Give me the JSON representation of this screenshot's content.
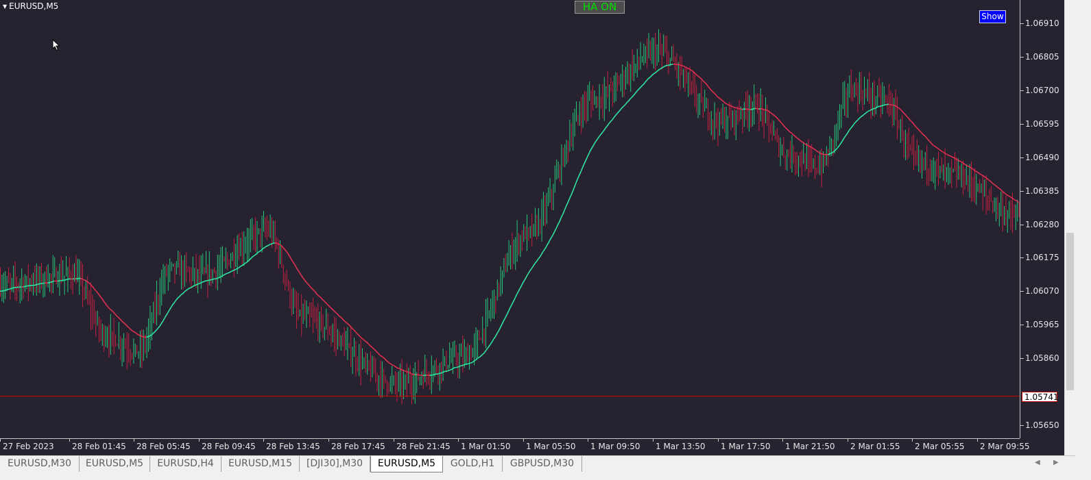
{
  "chart": {
    "symbol": "EURUSD,M5",
    "ha_button_label": "HA ON",
    "show_button_label": "Show",
    "current_price": "1.05741",
    "colors": {
      "background": "#272230",
      "bull": "#27c77a",
      "bear": "#c4213f",
      "ha_bull_line": "#2ee6a0",
      "ha_bear_line": "#e03050",
      "price_line": "#d00000",
      "scale_text": "#e6e6e6",
      "ha_text": "#00e000",
      "show_bg": "#0000ff"
    },
    "icons": [
      "triangle-down-icon",
      "mouse-cursor-icon",
      "arrow-left-icon",
      "arrow-right-icon"
    ]
  },
  "chart_data": {
    "type": "line",
    "x": [
      "27 Feb 2023",
      "28 Feb 01:45",
      "28 Feb 05:45",
      "28 Feb 09:45",
      "28 Feb 13:45",
      "28 Feb 17:45",
      "28 Feb 21:45",
      "1 Mar 01:50",
      "1 Mar 05:50",
      "1 Mar 09:50",
      "1 Mar 13:50",
      "1 Mar 17:50",
      "1 Mar 21:50",
      "2 Mar 01:55",
      "2 Mar 05:55",
      "2 Mar 09:55"
    ],
    "price_ticks": [
      "1.06910",
      "1.06805",
      "1.06700",
      "1.06595",
      "1.06490",
      "1.06385",
      "1.06280",
      "1.06175",
      "1.06070",
      "1.05965",
      "1.05860",
      "1.05650"
    ],
    "ylim": [
      1.0565,
      1.0691
    ],
    "price_line": 1.05741,
    "series": [
      {
        "values": [
          1.0609,
          1.0612,
          1.0593,
          1.0588,
          1.0614,
          1.0612,
          1.0626,
          1.0599,
          1.0578,
          1.0586,
          1.0625,
          1.0667,
          1.0682,
          1.066,
          1.0665,
          1.065,
          1.0646,
          1.067,
          1.0667,
          1.0648,
          1.0644,
          1.063
        ]
      }
    ],
    "path_x_index": [
      0,
      1,
      1.5,
      2,
      2.5,
      3,
      4,
      4.5,
      6,
      7,
      8,
      9,
      10,
      11,
      11.5,
      12,
      12.5,
      13,
      13.5,
      14,
      14.5,
      15.2
    ]
  },
  "tabs": [
    {
      "label": "EURUSD,M30",
      "active": false
    },
    {
      "label": "EURUSD,M5",
      "active": false
    },
    {
      "label": "EURUSD,H4",
      "active": false
    },
    {
      "label": "EURUSD,M15",
      "active": false
    },
    {
      "label": "[DJI30],M30",
      "active": false
    },
    {
      "label": "EURUSD,M5",
      "active": true
    },
    {
      "label": "GOLD,H1",
      "active": false
    },
    {
      "label": "GBPUSD,M30",
      "active": false
    }
  ]
}
